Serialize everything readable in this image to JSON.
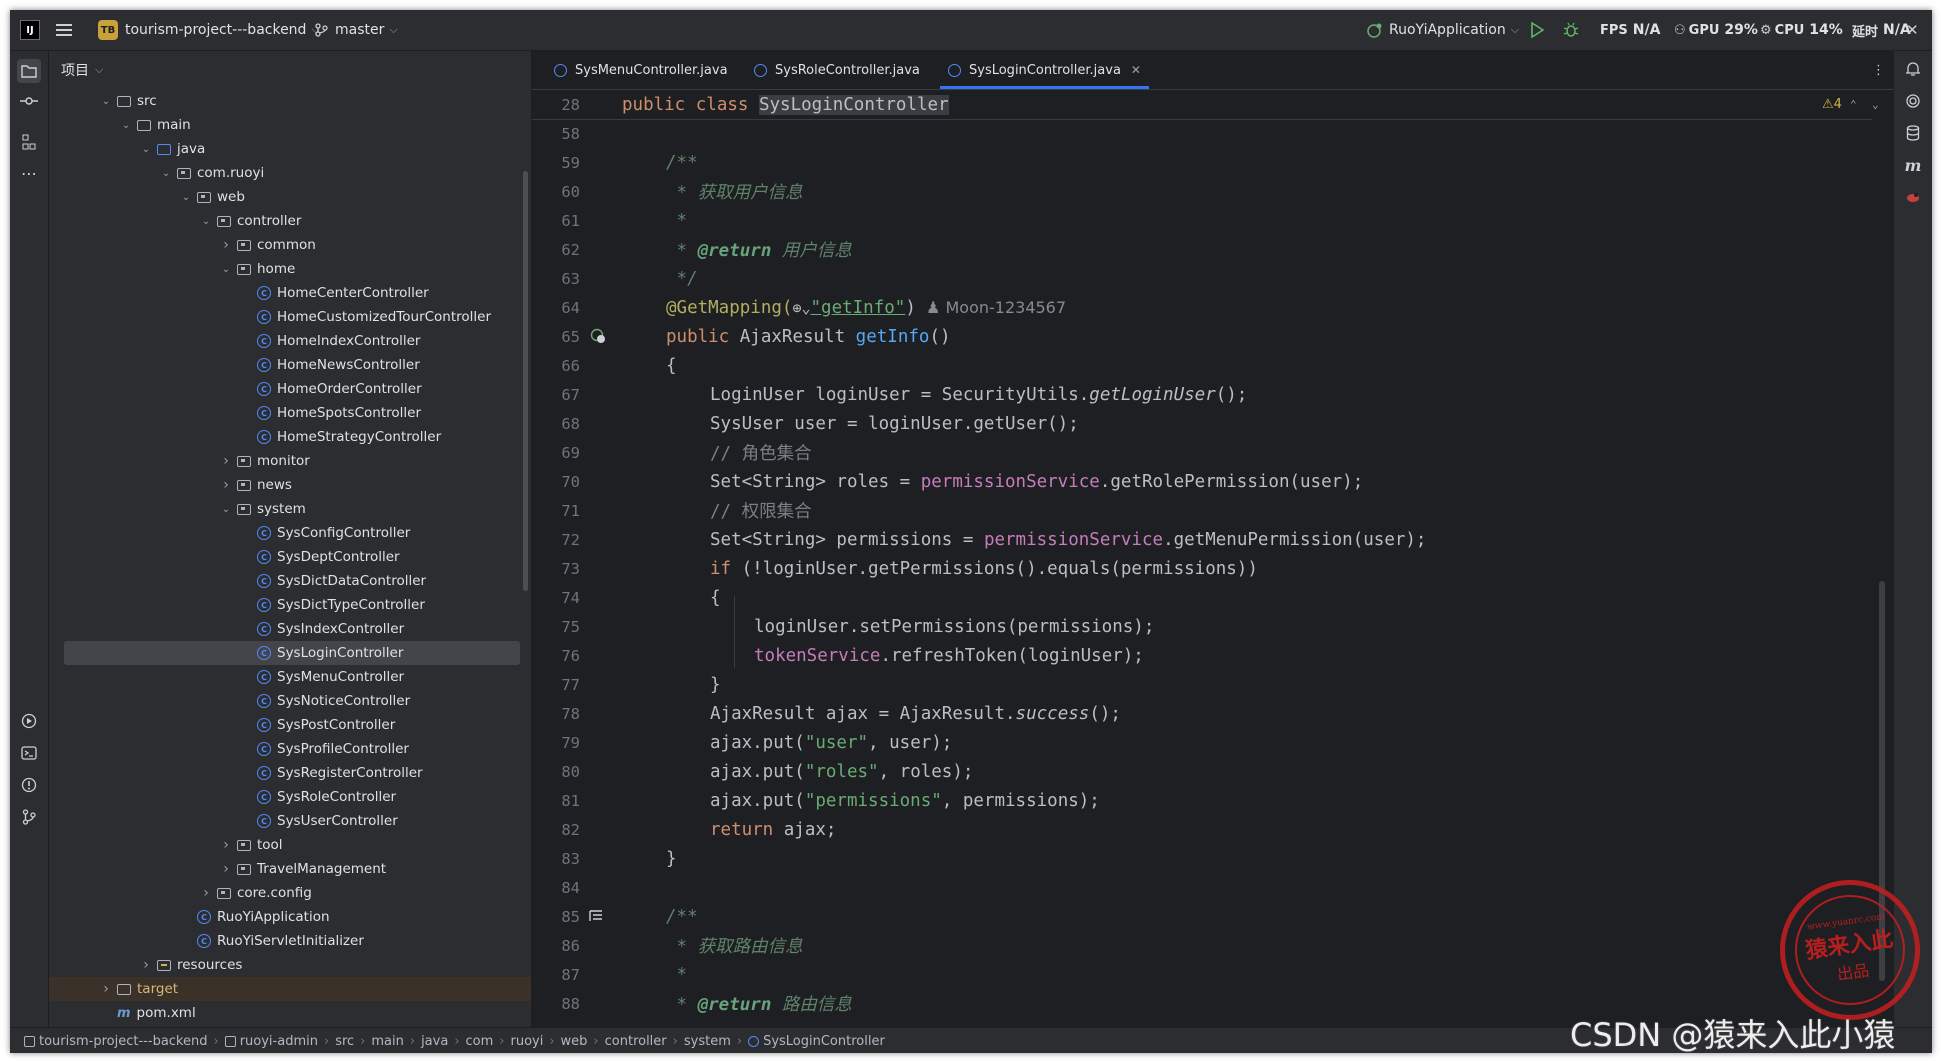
{
  "titlebar": {
    "logo": "IJ",
    "project_badge": "TB",
    "project_name": "tourism-project---backend",
    "branch": "master",
    "run_config": "RuoYiApplication",
    "fps_label": "FPS",
    "fps_value": "N/A",
    "gpu_label": "GPU",
    "gpu_value": "29%",
    "cpu_label": "CPU",
    "cpu_value": "14%",
    "latency_label": "延时",
    "latency_value": "N/A"
  },
  "project_panel": {
    "title": "项目",
    "tree": [
      {
        "label": "src",
        "depth": 1,
        "arrow": "v",
        "icon": "folder"
      },
      {
        "label": "main",
        "depth": 2,
        "arrow": "v",
        "icon": "folder"
      },
      {
        "label": "java",
        "depth": 3,
        "arrow": "v",
        "icon": "src"
      },
      {
        "label": "com.ruoyi",
        "depth": 4,
        "arrow": "v",
        "icon": "pkg"
      },
      {
        "label": "web",
        "depth": 5,
        "arrow": "v",
        "icon": "pkg"
      },
      {
        "label": "controller",
        "depth": 6,
        "arrow": "v",
        "icon": "pkg"
      },
      {
        "label": "common",
        "depth": 7,
        "arrow": ">",
        "icon": "pkg"
      },
      {
        "label": "home",
        "depth": 7,
        "arrow": "v",
        "icon": "pkg"
      },
      {
        "label": "HomeCenterController",
        "depth": 8,
        "arrow": "",
        "icon": "class"
      },
      {
        "label": "HomeCustomizedTourController",
        "depth": 8,
        "arrow": "",
        "icon": "class"
      },
      {
        "label": "HomeIndexController",
        "depth": 8,
        "arrow": "",
        "icon": "class"
      },
      {
        "label": "HomeNewsController",
        "depth": 8,
        "arrow": "",
        "icon": "class"
      },
      {
        "label": "HomeOrderController",
        "depth": 8,
        "arrow": "",
        "icon": "class"
      },
      {
        "label": "HomeSpotsController",
        "depth": 8,
        "arrow": "",
        "icon": "class"
      },
      {
        "label": "HomeStrategyController",
        "depth": 8,
        "arrow": "",
        "icon": "class"
      },
      {
        "label": "monitor",
        "depth": 7,
        "arrow": ">",
        "icon": "pkg"
      },
      {
        "label": "news",
        "depth": 7,
        "arrow": ">",
        "icon": "pkg"
      },
      {
        "label": "system",
        "depth": 7,
        "arrow": "v",
        "icon": "pkg"
      },
      {
        "label": "SysConfigController",
        "depth": 8,
        "arrow": "",
        "icon": "class"
      },
      {
        "label": "SysDeptController",
        "depth": 8,
        "arrow": "",
        "icon": "class"
      },
      {
        "label": "SysDictDataController",
        "depth": 8,
        "arrow": "",
        "icon": "class"
      },
      {
        "label": "SysDictTypeController",
        "depth": 8,
        "arrow": "",
        "icon": "class"
      },
      {
        "label": "SysIndexController",
        "depth": 8,
        "arrow": "",
        "icon": "class"
      },
      {
        "label": "SysLoginController",
        "depth": 8,
        "arrow": "",
        "icon": "class",
        "selected": true
      },
      {
        "label": "SysMenuController",
        "depth": 8,
        "arrow": "",
        "icon": "class"
      },
      {
        "label": "SysNoticeController",
        "depth": 8,
        "arrow": "",
        "icon": "class"
      },
      {
        "label": "SysPostController",
        "depth": 8,
        "arrow": "",
        "icon": "class"
      },
      {
        "label": "SysProfileController",
        "depth": 8,
        "arrow": "",
        "icon": "class"
      },
      {
        "label": "SysRegisterController",
        "depth": 8,
        "arrow": "",
        "icon": "class"
      },
      {
        "label": "SysRoleController",
        "depth": 8,
        "arrow": "",
        "icon": "class"
      },
      {
        "label": "SysUserController",
        "depth": 8,
        "arrow": "",
        "icon": "class"
      },
      {
        "label": "tool",
        "depth": 7,
        "arrow": ">",
        "icon": "pkg"
      },
      {
        "label": "TravelManagement",
        "depth": 7,
        "arrow": ">",
        "icon": "pkg"
      },
      {
        "label": "core.config",
        "depth": 6,
        "arrow": ">",
        "icon": "pkg"
      },
      {
        "label": "RuoYiApplication",
        "depth": 5,
        "arrow": "",
        "icon": "class"
      },
      {
        "label": "RuoYiServletInitializer",
        "depth": 5,
        "arrow": "",
        "icon": "class"
      },
      {
        "label": "resources",
        "depth": 3,
        "arrow": ">",
        "icon": "res"
      },
      {
        "label": "target",
        "depth": 1,
        "arrow": ">",
        "icon": "folder",
        "target": true
      },
      {
        "label": "pom.xml",
        "depth": 1,
        "arrow": "",
        "icon": "m"
      }
    ]
  },
  "editor": {
    "tabs": [
      {
        "label": "SysMenuController.java"
      },
      {
        "label": "SysRoleController.java"
      },
      {
        "label": "SysLoginController.java",
        "active": true
      }
    ],
    "warnings": "4",
    "sticky_line_number": "28",
    "line_numbers": [
      "58",
      "59",
      "60",
      "61",
      "62",
      "63",
      "64",
      "65",
      "66",
      "67",
      "68",
      "69",
      "70",
      "71",
      "72",
      "73",
      "74",
      "75",
      "76",
      "77",
      "78",
      "79",
      "80",
      "81",
      "82",
      "83",
      "84",
      "85",
      "86",
      "87",
      "88"
    ],
    "code": {
      "sticky_kw": "public class ",
      "sticky_name": "SysLoginController",
      "l59": "/**",
      "l60": " * 获取用户信息",
      "l61": " *",
      "l62_star": " * ",
      "l62_tag": "@return",
      "l62_text": " 用户信息",
      "l63": " */",
      "l64_ann": "@GetMapping(",
      "l64_globe": "🌐",
      "l64_str": "\"getInfo\"",
      "l64_close": ")",
      "l64_author": "Moon-1234567",
      "l65_kw": "public ",
      "l65_type": "AjaxResult ",
      "l65_fn": "getInfo",
      "l65_rest": "()",
      "l66": "{",
      "l67_a": "LoginUser loginUser = SecurityUtils.",
      "l67_b": "getLoginUser",
      "l67_c": "();",
      "l68": "SysUser user = loginUser.getUser();",
      "l69": "// 角色集合",
      "l70_a": "Set<String> roles = ",
      "l70_b": "permissionService",
      "l70_c": ".getRolePermission(user);",
      "l71": "// 权限集合",
      "l72_a": "Set<String> permissions = ",
      "l72_b": "permissionService",
      "l72_c": ".getMenuPermission(user);",
      "l73_kw": "if ",
      "l73_rest": "(!loginUser.getPermissions().equals(permissions))",
      "l74": "{",
      "l75": "loginUser.setPermissions(permissions);",
      "l76_a": "tokenService",
      "l76_b": ".refreshToken(loginUser);",
      "l77": "}",
      "l78_a": "AjaxResult ajax = AjaxResult.",
      "l78_b": "success",
      "l78_c": "();",
      "l79_a": "ajax.put(",
      "l79_s": "\"user\"",
      "l79_b": ", user);",
      "l80_a": "ajax.put(",
      "l80_s": "\"roles\"",
      "l80_b": ", roles);",
      "l81_a": "ajax.put(",
      "l81_s": "\"permissions\"",
      "l81_b": ", permissions);",
      "l82_kw": "return ",
      "l82_rest": "ajax;",
      "l83": "}",
      "l85": "/**",
      "l86": " * 获取路由信息",
      "l87": " *",
      "l88_star": " * ",
      "l88_tag": "@return",
      "l88_text": " 路由信息"
    }
  },
  "statusbar": {
    "breadcrumb": [
      "tourism-project---backend",
      "ruoyi-admin",
      "src",
      "main",
      "java",
      "com",
      "ruoyi",
      "web",
      "controller",
      "system",
      "SysLoginController"
    ]
  },
  "watermark": {
    "text": "CSDN @猿来入此小猿",
    "stamp_url": "www.yuanrc.com",
    "stamp_main": "猿来入此",
    "stamp_sub": "出品"
  },
  "colors": {
    "accent": "#3574f0",
    "keyword": "#cf8e6d",
    "string": "#6aab73",
    "field": "#c77dbb",
    "function": "#56a8f5",
    "annotation": "#b3ae60"
  }
}
